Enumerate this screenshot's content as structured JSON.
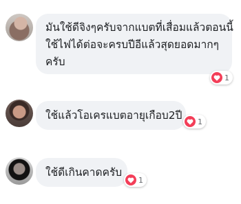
{
  "comments": [
    {
      "lines": [
        "มันใช้ดีจิงๆครับจากแบตที่เสื่อมแล้วตอนนี้",
        "ใช้ไฟได้ต่อจะครบปีอีแล้วสุดยอดมากๆ",
        "ครับ"
      ],
      "reaction": {
        "icon": "heart-icon",
        "count": "1"
      }
    },
    {
      "lines": [
        "ใช้แล้วโอเครแบตอายุเกือบ2ปี"
      ],
      "reaction": {
        "icon": "heart-icon",
        "count": "1"
      }
    },
    {
      "lines": [
        "ใช้ดีเกินคาดครับ"
      ],
      "reaction": {
        "icon": "heart-icon",
        "count": "1"
      }
    }
  ],
  "colors": {
    "bubble": "#f0f2f5",
    "heart": "#f33e58",
    "text": "#1c1e21",
    "count": "#65676b"
  }
}
